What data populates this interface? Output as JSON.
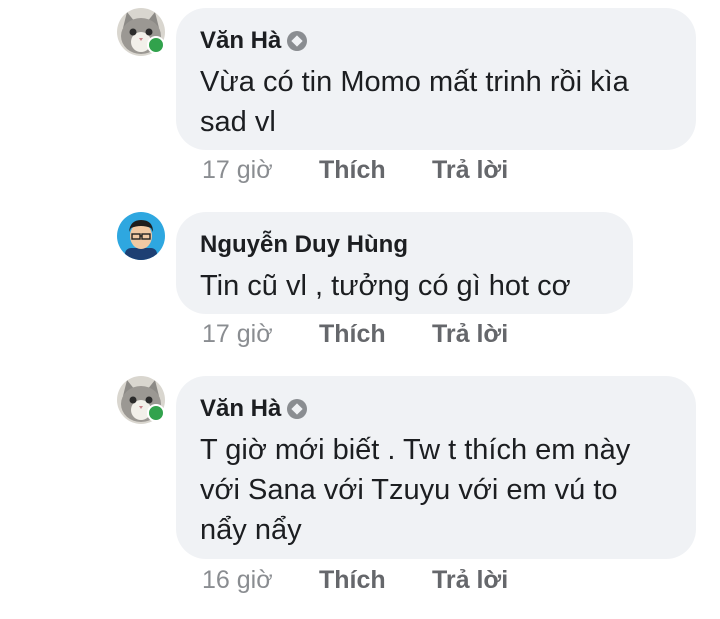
{
  "comments": [
    {
      "author": "Văn Hà",
      "verified": true,
      "online": true,
      "avatar_icon": "cat-avatar",
      "text": "Vừa có tin Momo mất trinh rồi kìa sad vl",
      "time": "17 giờ",
      "like_label": "Thích",
      "reply_label": "Trả lời"
    },
    {
      "author": "Nguyễn Duy Hùng",
      "verified": false,
      "online": false,
      "avatar_icon": "person-avatar",
      "text": "Tin cũ vl , tưởng có gì hot cơ",
      "time": "17 giờ",
      "like_label": "Thích",
      "reply_label": "Trả lời"
    },
    {
      "author": "Văn Hà",
      "verified": true,
      "online": true,
      "avatar_icon": "cat-avatar",
      "text": "T giờ mới biết . Tw t thích em này với Sana với Tzuyu với em vú to nẩy nẩy",
      "time": "16 giờ",
      "like_label": "Thích",
      "reply_label": "Trả lời"
    }
  ],
  "colors": {
    "bubble": "#f0f2f5",
    "text": "#1c1e21",
    "meta": "#65676b",
    "online": "#31a24c"
  }
}
